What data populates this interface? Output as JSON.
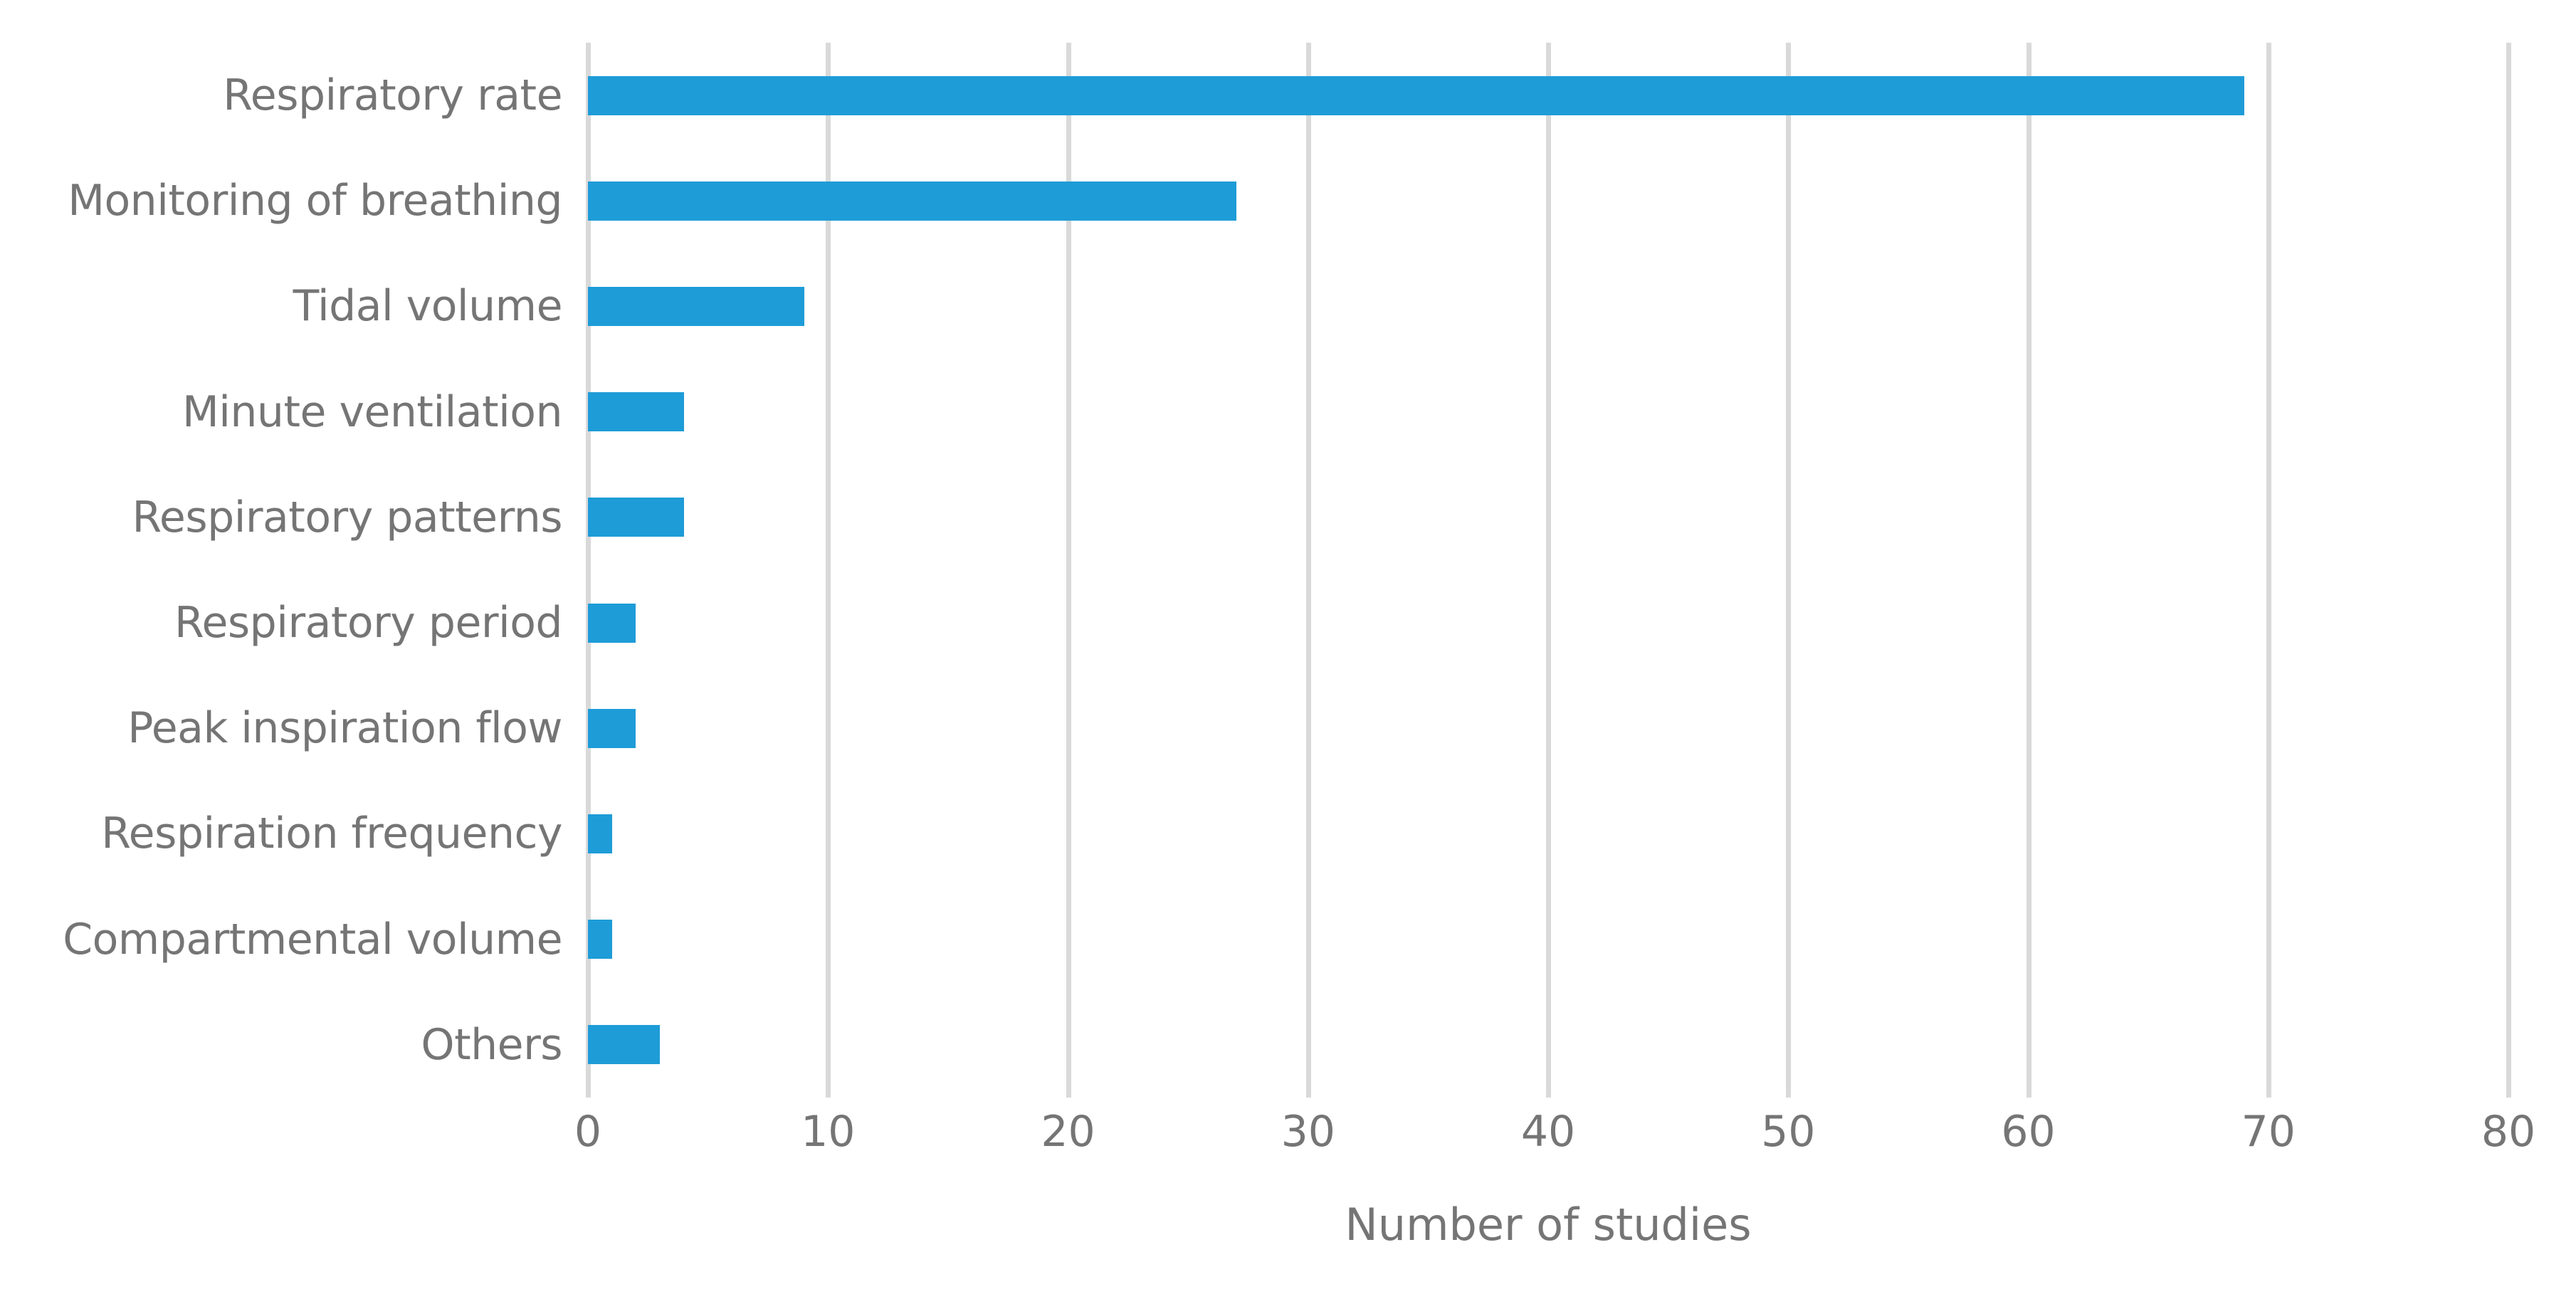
{
  "chart_data": {
    "type": "bar",
    "orientation": "horizontal",
    "title": "",
    "subtitle": "",
    "xlabel": "Number of studies",
    "ylabel": "",
    "categories": [
      "Respiratory rate",
      "Monitoring of breathing",
      "Tidal volume",
      "Minute ventilation",
      "Respiratory patterns",
      "Respiratory period",
      "Peak inspiration flow",
      "Respiration frequency",
      "Compartmental volume",
      "Others"
    ],
    "values": [
      69,
      27,
      9,
      4,
      4,
      2,
      2,
      1,
      1,
      3
    ],
    "xlim": [
      0,
      80
    ],
    "xticks": [
      0,
      10,
      20,
      30,
      40,
      50,
      60,
      70,
      80
    ],
    "xtick_labels": [
      "0",
      "10",
      "20",
      "30",
      "40",
      "50",
      "60",
      "70",
      "80"
    ],
    "grid": "vertical-major",
    "legend": "none",
    "bar_color": "#1e9cd7",
    "gridline_color": "#d9d9d9",
    "text_color": "#757575",
    "background_color": "#ffffff"
  }
}
